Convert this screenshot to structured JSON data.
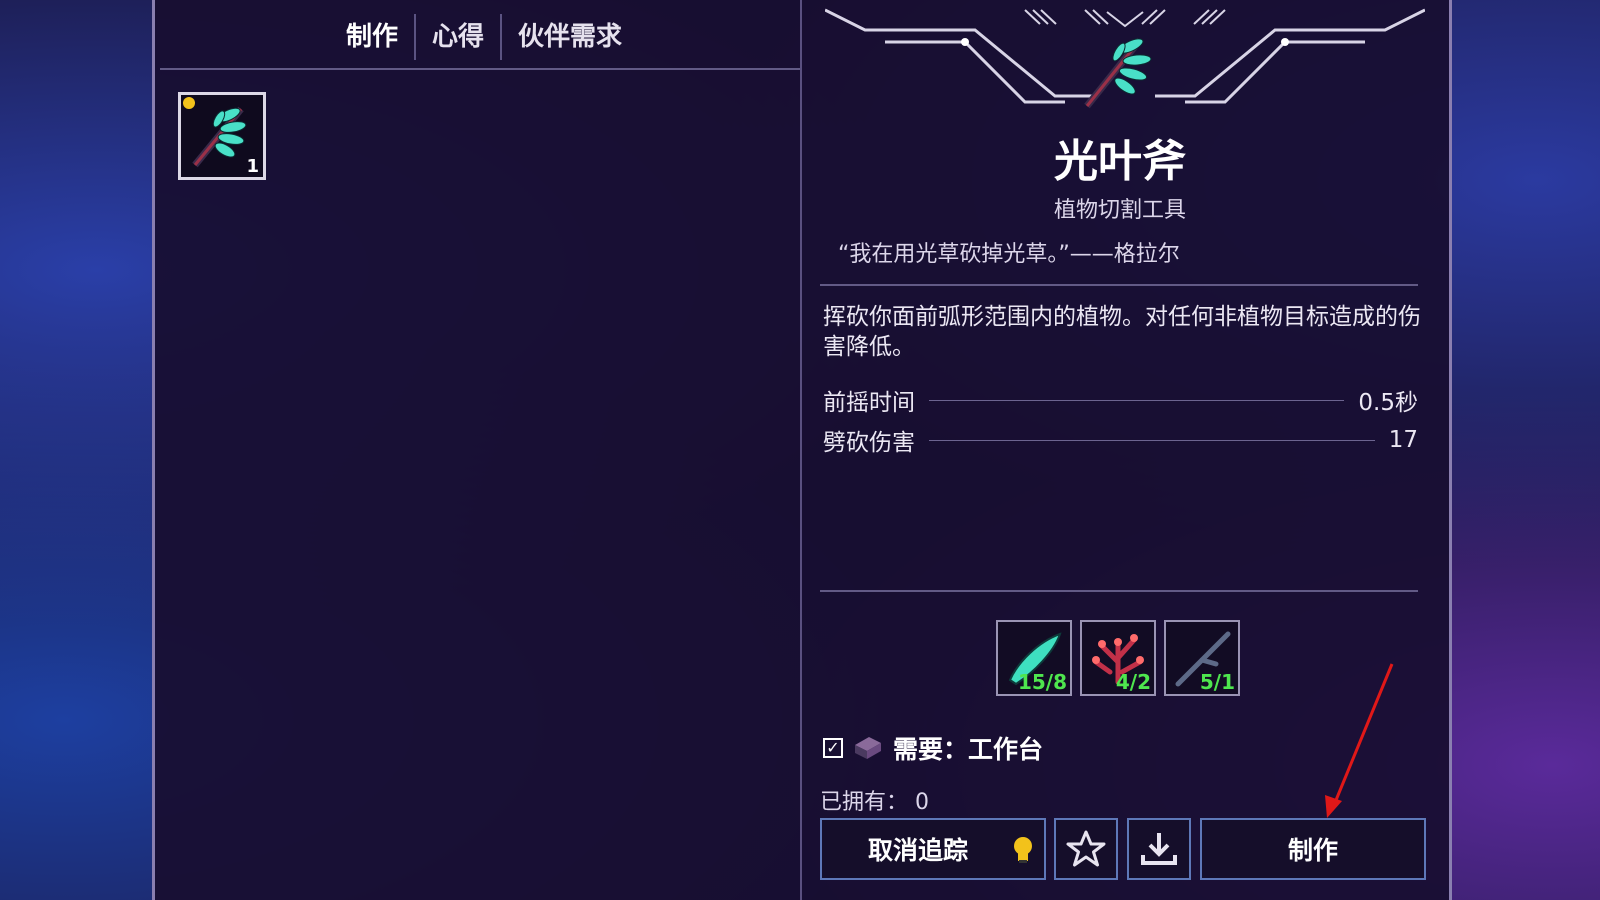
{
  "tabs": [
    {
      "label": "制作",
      "active": true
    },
    {
      "label": "心得",
      "active": false
    },
    {
      "label": "伙伴需求",
      "active": false
    }
  ],
  "slot": {
    "count": "1",
    "icon": "glowleaf-axe-icon"
  },
  "item": {
    "name": "光叶斧",
    "type": "植物切割工具",
    "quote": "“我在用光草砍掉光草。”——格拉尔",
    "description": "挥砍你面前弧形范围内的植物。对任何非植物目标造成的伤害降低。"
  },
  "stats": [
    {
      "label": "前摇时间",
      "value": "0.5秒"
    },
    {
      "label": "劈砍伤害",
      "value": "17"
    }
  ],
  "materials": [
    {
      "icon": "glowleaf-icon",
      "count": "15/8"
    },
    {
      "icon": "red-coral-icon",
      "count": "4/2"
    },
    {
      "icon": "branch-icon",
      "count": "5/1"
    }
  ],
  "requirement": {
    "checked": true,
    "label": "需要：工作台"
  },
  "owned": "已拥有：  0",
  "buttons": {
    "untrack": "取消追踪",
    "craft": "制作"
  },
  "colors": {
    "accent": "#5e78b8",
    "count_green": "#4ee64e",
    "tracking_bulb": "#f2c21b",
    "annotation_arrow": "#e01818"
  }
}
